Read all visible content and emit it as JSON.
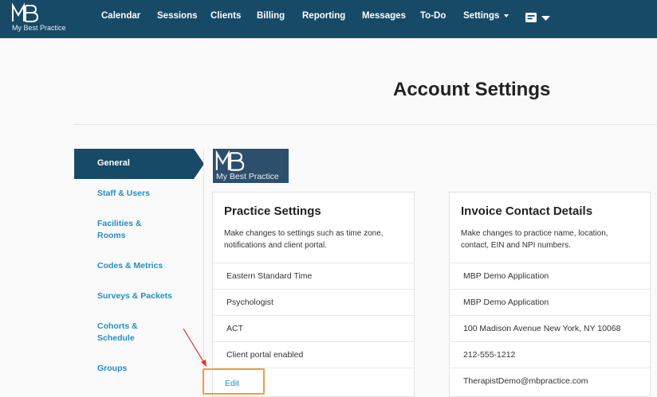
{
  "brand": {
    "logo_letters": "MB",
    "name": "My Best Practice"
  },
  "nav": {
    "items": [
      "Calendar",
      "Sessions",
      "Clients",
      "Billing",
      "Reporting",
      "Messages",
      "To-Do"
    ],
    "settings_label": "Settings"
  },
  "page": {
    "title": "Account Settings"
  },
  "sidebar": {
    "items": [
      "General",
      "Staff & Users",
      "Facilities & Rooms",
      "Codes & Metrics",
      "Surveys & Packets",
      "Cohorts & Schedule",
      "Groups"
    ],
    "active_index": 0
  },
  "practice_settings": {
    "title": "Practice Settings",
    "description": "Make changes to settings such as time zone, notifications and client portal.",
    "rows": [
      "Eastern Standard Time",
      "Psychologist",
      "ACT",
      "Client portal enabled"
    ],
    "edit_label": "Edit"
  },
  "invoice_contact": {
    "title": "Invoice Contact Details",
    "description": "Make changes to practice name, location, contact, EIN and NPI numbers.",
    "rows": [
      "MBP Demo Application",
      "MBP Demo Application",
      "100 Madison Avenue New York, NY 10068",
      "212-555-1212",
      "TherapistDemo@mbpractice.com"
    ]
  },
  "colors": {
    "nav_bg": "#174a67",
    "link": "#1f8fc7",
    "highlight": "#f7993a",
    "arrow": "#e5312b"
  },
  "icons": {
    "messages": "message-box-icon",
    "annotation": "red-arrow-icon"
  }
}
